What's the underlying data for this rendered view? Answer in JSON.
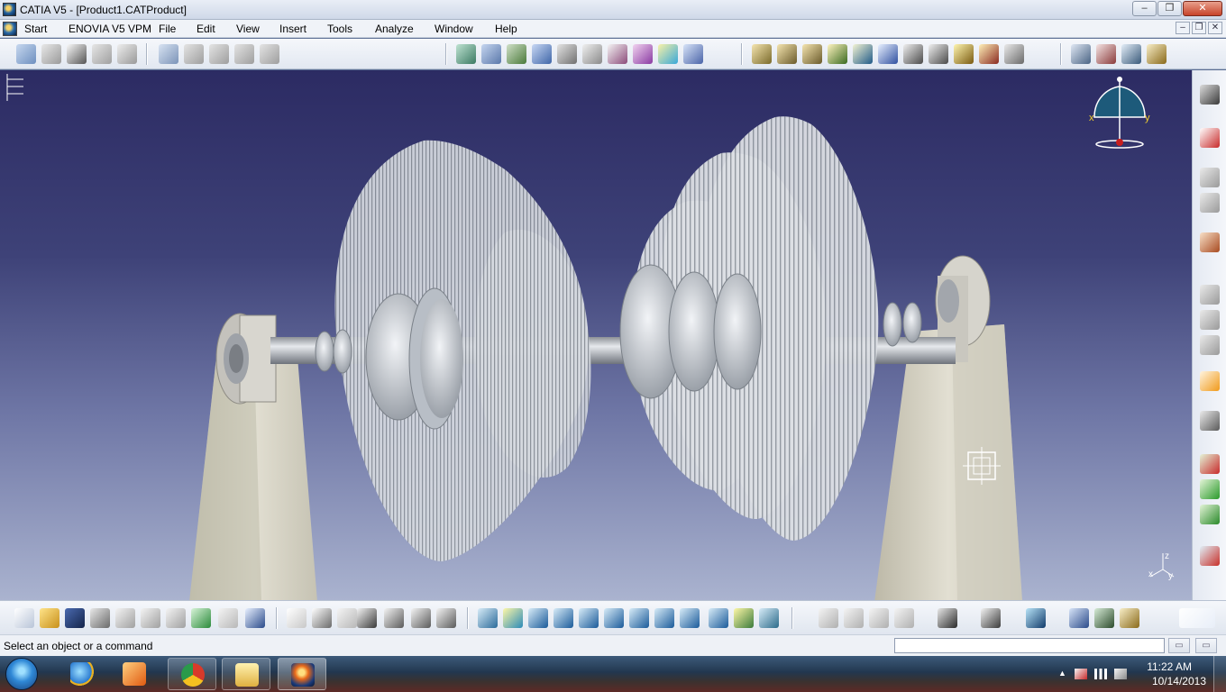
{
  "window": {
    "title": "CATIA V5 - [Product1.CATProduct]",
    "buttons": {
      "minimize": "–",
      "maximize": "❐",
      "close": "✕"
    }
  },
  "menu": {
    "items": [
      "Start",
      "ENOVIA V5 VPM",
      "File",
      "Edit",
      "View",
      "Insert",
      "Tools",
      "Analyze",
      "Window",
      "Help"
    ],
    "mdi_buttons": {
      "minimize": "–",
      "restore": "❐",
      "close": "✕"
    }
  },
  "viewport": {
    "compass_labels": {
      "x": "x",
      "y": "y"
    },
    "axis_labels": {
      "x": "x",
      "y": "y",
      "z": "z"
    },
    "tree_glyph": "tree-icon"
  },
  "statusbar": {
    "message": "Select an object or a command",
    "command_input": "",
    "buttons": [
      "▭",
      "▭"
    ]
  },
  "taskbar": {
    "apps": [
      "start-orb",
      "internet-explorer-icon",
      "media-player-icon",
      "chrome-icon",
      "explorer-folder-icon",
      "catia-icon"
    ],
    "time": "11:22 AM",
    "date": "10/14/2013"
  },
  "colors": {
    "viewport_top": "#2c2b63",
    "viewport_bottom": "#aab3cf",
    "blade": "#d9dde2",
    "pedestal": "#d8d5c6",
    "accent_orange": "#f09a1a"
  }
}
